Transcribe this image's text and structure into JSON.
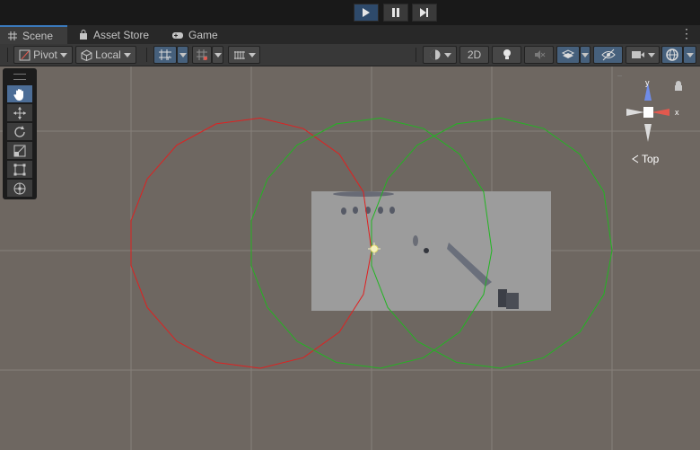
{
  "playbar": {
    "play_icon": "play-icon",
    "pause_icon": "pause-icon",
    "step_icon": "step-forward-icon"
  },
  "tabs": [
    {
      "label": "Scene",
      "icon": "grid-icon"
    },
    {
      "label": "Asset Store",
      "icon": "shopping-bag-icon"
    },
    {
      "label": "Game",
      "icon": "gamepad-icon"
    }
  ],
  "toolbar": {
    "pivot_label": "Pivot",
    "local_label": "Local",
    "mode_2d_label": "2D"
  },
  "orientation": {
    "y_label": "y",
    "x_label": "x",
    "view_label": "Top"
  },
  "colors": {
    "accent": "#3a79bb",
    "viewport_bg": "#6e6761",
    "gizmo_x": "#e2594e",
    "gizmo_y": "#6f8ce8",
    "collider_red": "#e02020",
    "collider_green": "#22b522"
  }
}
